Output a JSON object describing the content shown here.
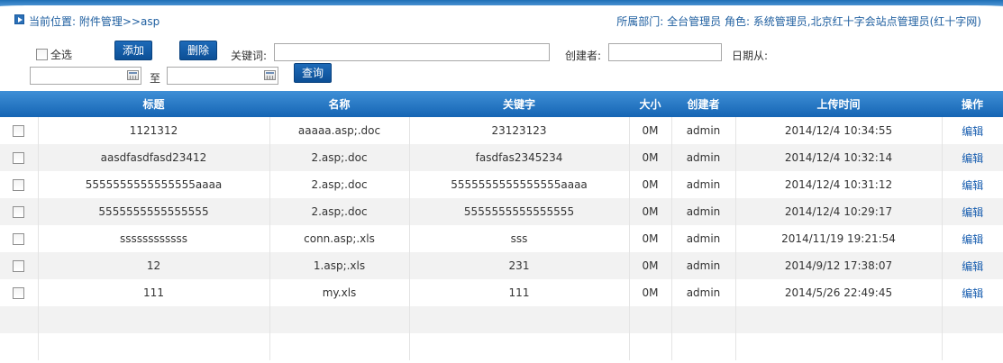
{
  "location": {
    "text": "当前位置: 附件管理>>asp",
    "department": "所属部门: 全台管理员    角色: 系统管理员,北京红十字会站点管理员(红十字网)"
  },
  "toolbar": {
    "select_all_label": "全选",
    "add_label": "添加",
    "delete_label": "删除",
    "keyword_label": "关键词:",
    "keyword_value": "",
    "creator_label": "创建者:",
    "creator_value": "",
    "date_from_label": "日期从:",
    "date_from_value": "",
    "to_label": "至",
    "date_to_value": "",
    "query_label": "查询"
  },
  "table": {
    "columns": [
      "",
      "标题",
      "名称",
      "关键字",
      "大小",
      "创建者",
      "上传时间",
      "操作"
    ],
    "rows": [
      {
        "title": "1121312",
        "name": "aaaaa.asp;.doc",
        "keyword": "23123123",
        "size": "0M",
        "creator": "admin",
        "time": "2014/12/4 10:34:55",
        "action": "编辑"
      },
      {
        "title": "aasdfasdfasd23412",
        "name": "2.asp;.doc",
        "keyword": "fasdfas2345234",
        "size": "0M",
        "creator": "admin",
        "time": "2014/12/4 10:32:14",
        "action": "编辑"
      },
      {
        "title": "5555555555555555aaaa",
        "name": "2.asp;.doc",
        "keyword": "5555555555555555aaaa",
        "size": "0M",
        "creator": "admin",
        "time": "2014/12/4 10:31:12",
        "action": "编辑"
      },
      {
        "title": "5555555555555555",
        "name": "2.asp;.doc",
        "keyword": "5555555555555555",
        "size": "0M",
        "creator": "admin",
        "time": "2014/12/4 10:29:17",
        "action": "编辑"
      },
      {
        "title": "ssssssssssss",
        "name": "conn.asp;.xls",
        "keyword": "sss",
        "size": "0M",
        "creator": "admin",
        "time": "2014/11/19 19:21:54",
        "action": "编辑"
      },
      {
        "title": "12",
        "name": "1.asp;.xls",
        "keyword": "231",
        "size": "0M",
        "creator": "admin",
        "time": "2014/9/12 17:38:07",
        "action": "编辑"
      },
      {
        "title": "111",
        "name": "my.xls",
        "keyword": "111",
        "size": "0M",
        "creator": "admin",
        "time": "2014/5/26 22:49:45",
        "action": "编辑"
      }
    ]
  },
  "icons": {
    "location": "play-square-icon",
    "calendar": "calendar-icon"
  },
  "colors": {
    "header_blue": "#1565b4",
    "button_blue": "#0c4f96",
    "link_blue": "#1a5fb0",
    "stripe_gray": "#f2f2f2"
  }
}
